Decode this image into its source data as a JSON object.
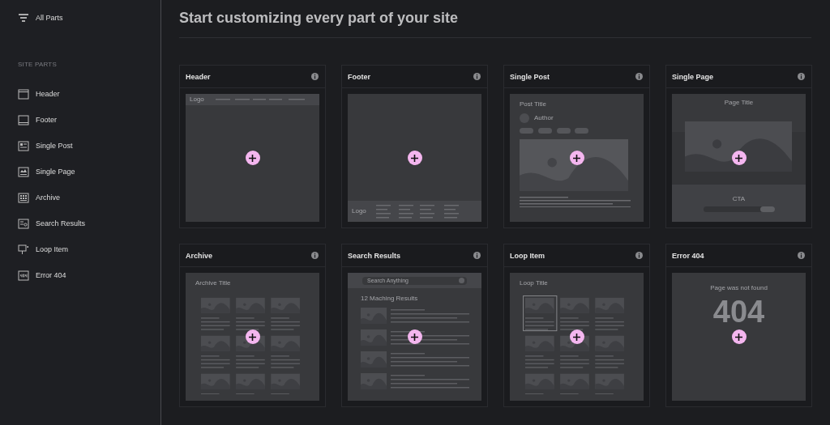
{
  "sidebar": {
    "all_parts": "All Parts",
    "section_label": "SITE PARTS",
    "items": [
      {
        "label": "Header",
        "kind": "header"
      },
      {
        "label": "Footer",
        "kind": "footer"
      },
      {
        "label": "Single Post",
        "kind": "single_post"
      },
      {
        "label": "Single Page",
        "kind": "single_page"
      },
      {
        "label": "Archive",
        "kind": "archive"
      },
      {
        "label": "Search Results",
        "kind": "search"
      },
      {
        "label": "Loop Item",
        "kind": "loop"
      },
      {
        "label": "Error 404",
        "kind": "error"
      }
    ]
  },
  "main": {
    "title": "Start customizing every part of your site",
    "cards": [
      {
        "title": "Header",
        "kind": "header",
        "texts": {
          "logo": "Logo"
        }
      },
      {
        "title": "Footer",
        "kind": "footer",
        "texts": {
          "logo": "Logo"
        }
      },
      {
        "title": "Single Post",
        "kind": "single_post",
        "texts": {
          "title": "Post Title",
          "author": "Author"
        }
      },
      {
        "title": "Single Page",
        "kind": "single_page",
        "texts": {
          "title": "Page Title",
          "cta": "CTA"
        }
      },
      {
        "title": "Archive",
        "kind": "archive",
        "texts": {
          "title": "Archive Title"
        }
      },
      {
        "title": "Search Results",
        "kind": "search",
        "texts": {
          "placeholder": "Search Anything",
          "heading": "12 Maching Results"
        }
      },
      {
        "title": "Loop Item",
        "kind": "loop",
        "texts": {
          "title": "Loop Title"
        }
      },
      {
        "title": "Error 404",
        "kind": "error",
        "texts": {
          "message": "Page was not found",
          "code": "404"
        }
      }
    ]
  }
}
